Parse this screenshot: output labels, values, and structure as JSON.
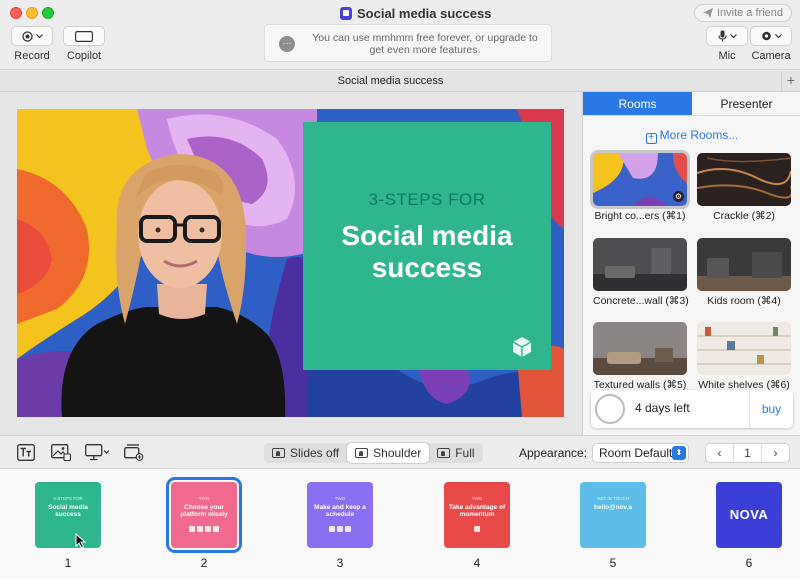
{
  "window": {
    "title": "Social media success",
    "invite_label": "Invite a friend"
  },
  "toolbar": {
    "record_label": "Record",
    "copilot_label": "Copilot",
    "mic_label": "Mic",
    "camera_label": "Camera",
    "banner_text": "You can use mmhmm free forever, or upgrade to get even more features."
  },
  "tab": {
    "title": "Social media success"
  },
  "stage": {
    "slide_kicker": "3-STEPS FOR",
    "slide_title": "Social media success",
    "slide_color": "#2fb68e"
  },
  "panel": {
    "tabs": [
      {
        "label": "Rooms",
        "active": true
      },
      {
        "label": "Presenter",
        "active": false
      }
    ],
    "more_rooms_label": "More Rooms...",
    "rooms": [
      {
        "label": "Bright co...ers (⌘1)",
        "selected": true
      },
      {
        "label": "Crackle (⌘2)"
      },
      {
        "label": "Concrete...wall (⌘3)"
      },
      {
        "label": "Kids room (⌘4)"
      },
      {
        "label": "Textured walls (⌘5)"
      },
      {
        "label": "White shelves (⌘6)"
      }
    ],
    "trial": {
      "days_left": "4 days left",
      "buy_label": "buy"
    }
  },
  "bottombar": {
    "modes": [
      {
        "label": "Slides off",
        "active": false
      },
      {
        "label": "Shoulder",
        "active": true
      },
      {
        "label": "Full",
        "active": false
      }
    ],
    "appearance_label": "Appearance:",
    "appearance_value": "Room Default",
    "page_number": "1"
  },
  "slides": [
    {
      "number": "1",
      "kicker": "3-STEPS FOR",
      "title": "Social media success",
      "color": "#2fb68e",
      "selected": false
    },
    {
      "number": "2",
      "kicker": "TWO",
      "title": "Choose your platform wisely",
      "color": "#f06a8f",
      "selected": true
    },
    {
      "number": "3",
      "kicker": "TWO",
      "title": "Make and keep a schedule",
      "color": "#8a6ff0",
      "selected": false
    },
    {
      "number": "4",
      "kicker": "TWO",
      "title": "Take advantage of momentum",
      "color": "#e84a4a",
      "selected": false
    },
    {
      "number": "5",
      "kicker": "GET IN TOUCH",
      "title": "hello@nov.a",
      "color": "#5bbde8",
      "selected": false
    },
    {
      "number": "6",
      "big": "NOVA",
      "color": "#3b3fd8",
      "selected": false
    }
  ]
}
